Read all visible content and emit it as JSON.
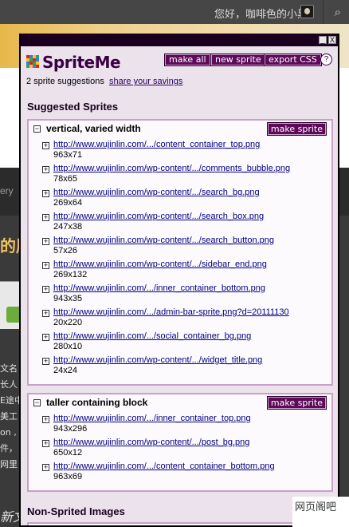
{
  "adminbar": {
    "greeting": "您好，咖啡色的小黑",
    "avatar_icon": "avatar-image",
    "search_icon": "search-icon"
  },
  "background": {
    "nav_text": "ery",
    "title_text": "的朋",
    "text_lines": [
      "文名",
      "长人",
      "E途中",
      "美工",
      "on ,",
      "件，",
      "网里"
    ],
    "title2_text": "新文",
    "watermark": "网页阁吧"
  },
  "spriteme": {
    "brand": "SpriteMe",
    "buttons": {
      "make_all": "make all",
      "new_sprite": "new sprite",
      "export_css": "export CSS",
      "help": "?"
    },
    "window_buttons": {
      "minimize": "_",
      "close": "X"
    },
    "suggestions_count": "2 sprite suggestions",
    "share_link": "share your savings",
    "suggested_title": "Suggested Sprites",
    "non_sprited_title": "Non-Sprited Images",
    "make_sprite_label": "make sprite",
    "groups": [
      {
        "title": "vertical, varied width",
        "items": [
          {
            "url": "http://www.wujinlin.com/.../content_container_top.png",
            "size": "963x71"
          },
          {
            "url": "http://www.wujinlin.com/wp-content/.../comments_bubble.png",
            "size": "78x65"
          },
          {
            "url": "http://www.wujinlin.com/wp-content/.../search_bg.png",
            "size": "269x64"
          },
          {
            "url": "http://www.wujinlin.com/wp-content/.../search_box.png",
            "size": "247x38"
          },
          {
            "url": "http://www.wujinlin.com/wp-content/.../search_button.png",
            "size": "57x26"
          },
          {
            "url": "http://www.wujinlin.com/wp-content/.../sidebar_end.png",
            "size": "269x132"
          },
          {
            "url": "http://www.wujinlin.com/.../inner_container_bottom.png",
            "size": "943x35"
          },
          {
            "url": "http://www.wujinlin.com/.../admin-bar-sprite.png?d=20111130",
            "size": "20x220"
          },
          {
            "url": "http://www.wujinlin.com/.../social_container_bg.png",
            "size": "280x10"
          },
          {
            "url": "http://www.wujinlin.com/wp-content/.../widget_title.png",
            "size": "24x24"
          }
        ]
      },
      {
        "title": "taller containing block",
        "items": [
          {
            "url": "http://www.wujinlin.com/.../inner_container_top.png",
            "size": "943x296"
          },
          {
            "url": "http://www.wujinlin.com/wp-content/.../post_bg.png",
            "size": "650x12"
          },
          {
            "url": "http://www.wujinlin.com/.../content_container_bottom.png",
            "size": "963x69"
          }
        ]
      }
    ]
  },
  "colors": {
    "panel_bg": "#ece2ec",
    "button_bg": "#5e0a5a",
    "brand_text": "#3a0044",
    "link": "#000080",
    "group_border": "#c9a0c9"
  }
}
